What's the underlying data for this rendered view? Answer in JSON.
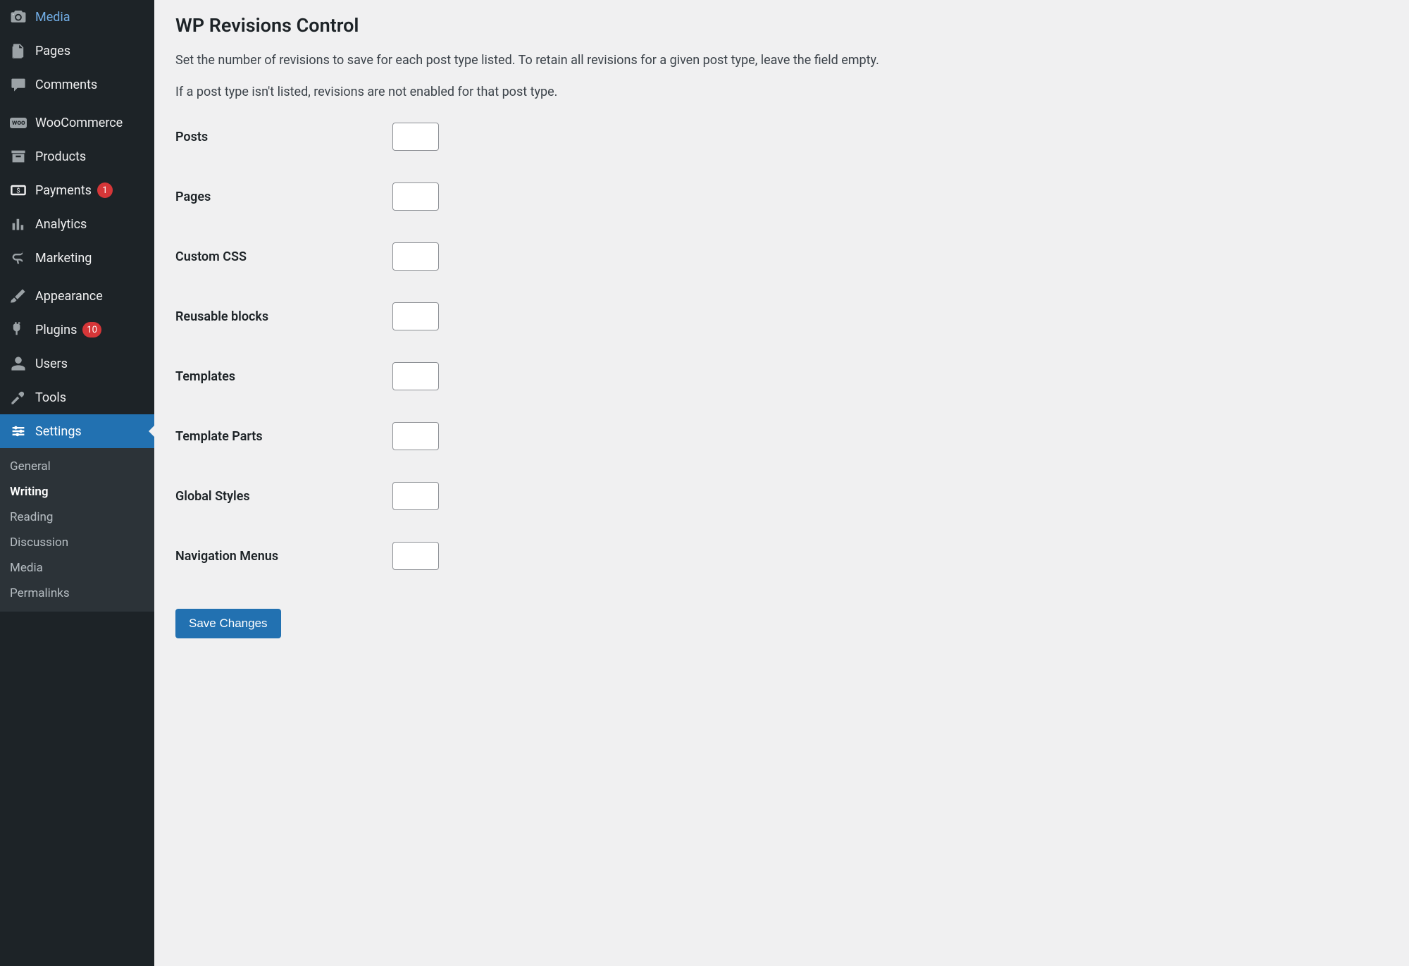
{
  "sidebar": {
    "items": [
      {
        "label": "Media",
        "icon": "media"
      },
      {
        "label": "Pages",
        "icon": "pages"
      },
      {
        "label": "Comments",
        "icon": "comments"
      },
      {
        "label": "WooCommerce",
        "icon": "woo"
      },
      {
        "label": "Products",
        "icon": "products"
      },
      {
        "label": "Payments",
        "icon": "payments",
        "badge": "1"
      },
      {
        "label": "Analytics",
        "icon": "analytics"
      },
      {
        "label": "Marketing",
        "icon": "marketing"
      },
      {
        "label": "Appearance",
        "icon": "appearance"
      },
      {
        "label": "Plugins",
        "icon": "plugins",
        "badge": "10"
      },
      {
        "label": "Users",
        "icon": "users"
      },
      {
        "label": "Tools",
        "icon": "tools"
      },
      {
        "label": "Settings",
        "icon": "settings"
      }
    ],
    "submenu": [
      {
        "label": "General"
      },
      {
        "label": "Writing"
      },
      {
        "label": "Reading"
      },
      {
        "label": "Discussion"
      },
      {
        "label": "Media"
      },
      {
        "label": "Permalinks"
      }
    ]
  },
  "page": {
    "title": "WP Revisions Control",
    "desc1": "Set the number of revisions to save for each post type listed. To retain all revisions for a given post type, leave the field empty.",
    "desc2": "If a post type isn't listed, revisions are not enabled for that post type.",
    "fields": [
      {
        "label": "Posts",
        "value": ""
      },
      {
        "label": "Pages",
        "value": ""
      },
      {
        "label": "Custom CSS",
        "value": ""
      },
      {
        "label": "Reusable blocks",
        "value": ""
      },
      {
        "label": "Templates",
        "value": ""
      },
      {
        "label": "Template Parts",
        "value": ""
      },
      {
        "label": "Global Styles",
        "value": ""
      },
      {
        "label": "Navigation Menus",
        "value": ""
      }
    ],
    "submit_label": "Save Changes"
  }
}
